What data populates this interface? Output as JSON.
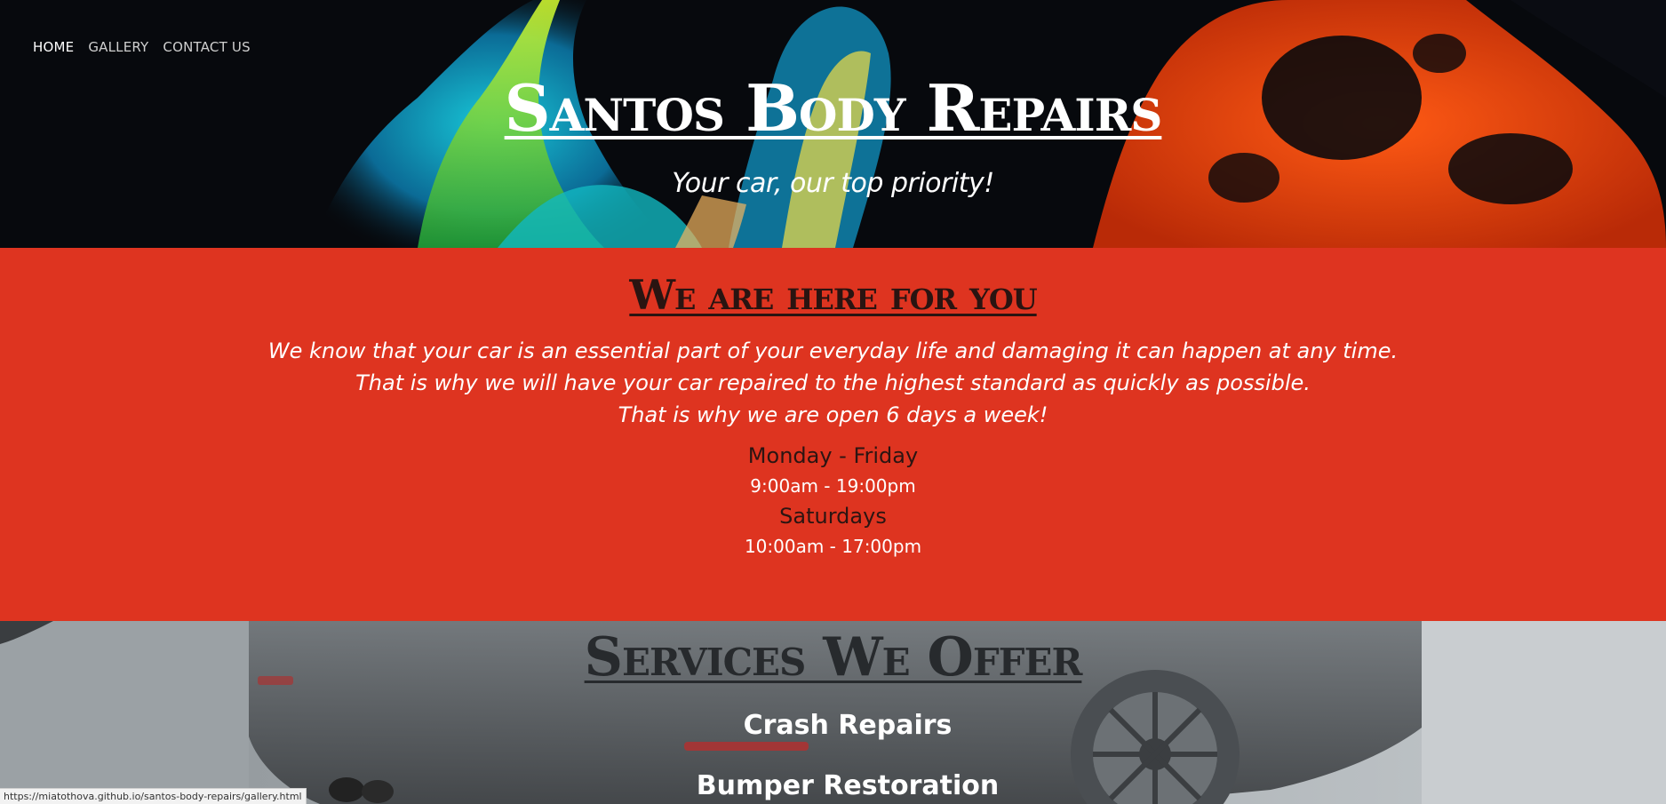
{
  "nav": {
    "home": "HOME",
    "gallery": "GALLERY",
    "contact": "CONTACT US"
  },
  "hero": {
    "title": "Santos Body Repairs",
    "tagline": "Your car, our top priority!"
  },
  "about": {
    "heading": "We are here for you",
    "lines": [
      "We know that your car is an essential part of your everyday life and damaging it can happen at any time.",
      "That is why we will have your car repaired to the highest standard as quickly as possible.",
      "That is why we are open 6 days a week!"
    ],
    "schedule": [
      {
        "day": "Monday - Friday",
        "hours": "9:00am - 19:00pm"
      },
      {
        "day": "Saturdays",
        "hours": "10:00am - 17:00pm"
      }
    ]
  },
  "services": {
    "heading": "Services We Offer",
    "items": [
      "Crash Repairs",
      "Bumper Restoration"
    ]
  },
  "status_bar": {
    "url": "https://miatothova.github.io/santos-body-repairs/gallery.html"
  },
  "colors": {
    "accent_red": "#de3420",
    "hero_bg": "#07090d"
  }
}
